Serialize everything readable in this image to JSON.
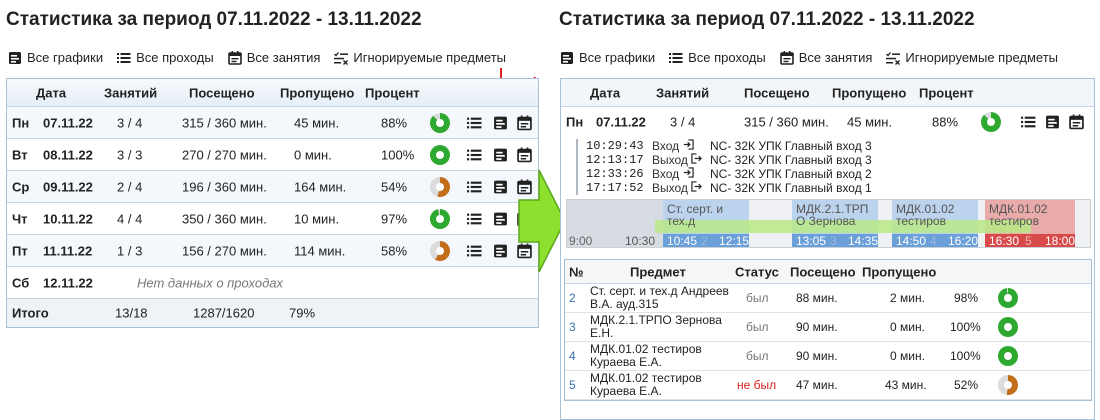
{
  "title": "Статистика за период 07.11.2022 - 13.11.2022",
  "toolbar": {
    "all_charts": "Все графики",
    "all_passes": "Все проходы",
    "all_lessons": "Все занятия",
    "ignored": "Игнорируемые предметы"
  },
  "table": {
    "headers": {
      "date": "Дата",
      "lessons": "Занятий",
      "attended": "Посещено",
      "missed": "Пропущено",
      "percent": "Процент"
    },
    "rows": [
      {
        "day": "Пн",
        "date": "07.11.22",
        "lessons": "3 / 4",
        "attended": "315 / 360 мин.",
        "missed": "45 мин.",
        "percent": "88%",
        "pct": 88
      },
      {
        "day": "Вт",
        "date": "08.11.22",
        "lessons": "3 / 3",
        "attended": "270 / 270 мин.",
        "missed": "0 мин.",
        "percent": "100%",
        "pct": 100
      },
      {
        "day": "Ср",
        "date": "09.11.22",
        "lessons": "2 / 4",
        "attended": "196 / 360 мин.",
        "missed": "164 мин.",
        "percent": "54%",
        "pct": 54
      },
      {
        "day": "Чт",
        "date": "10.11.22",
        "lessons": "4 / 4",
        "attended": "350 / 360 мин.",
        "missed": "10 мин.",
        "percent": "97%",
        "pct": 97
      },
      {
        "day": "Пт",
        "date": "11.11.22",
        "lessons": "1 / 3",
        "attended": "156 / 270 мин.",
        "missed": "114 мин.",
        "percent": "58%",
        "pct": 58
      }
    ],
    "saturday": {
      "day": "Сб",
      "date": "12.11.22",
      "note": "Нет данных о проходах"
    },
    "total": {
      "label": "Итого",
      "lessons": "13/18",
      "attended": "1287/1620",
      "percent": "79%"
    }
  },
  "expanded": {
    "day": "Пн",
    "date": "07.11.22",
    "lessons": "3 / 4",
    "attended": "315 / 360 мин.",
    "missed": "45 мин.",
    "percent": "88%",
    "pct": 88,
    "visits": [
      {
        "time": "10:29:43",
        "kind": "Вход",
        "dir": "in",
        "place": "NC- 32К УПК Главный вход 3"
      },
      {
        "time": "12:13:17",
        "kind": "Выход",
        "dir": "out",
        "place": "NC- 32К УПК Главный вход 3"
      },
      {
        "time": "12:33:26",
        "kind": "Вход",
        "dir": "in",
        "place": "NC- 32К УПК Главный вход 2"
      },
      {
        "time": "17:17:52",
        "kind": "Выход",
        "dir": "out",
        "place": "NC- 32К УПК Главный вход 1"
      }
    ],
    "timeline": {
      "day_start": "9:00",
      "lessons": [
        {
          "num": "1",
          "start": "9:00",
          "end": "10:30",
          "label": ""
        },
        {
          "num": "2",
          "start": "10:45",
          "end": "12:15",
          "label": "Ст. серт. и тех.д"
        },
        {
          "num": "3",
          "start": "13:05",
          "end": "14:35",
          "label": "МДК.2.1.ТРП О Зернова"
        },
        {
          "num": "4",
          "start": "14:50",
          "end": "16:20",
          "label": "МДК.01.02 тестиров"
        },
        {
          "num": "5",
          "start": "16:30",
          "end": "18:00",
          "label": "МДК.01.02 тестиров"
        }
      ]
    },
    "subtable": {
      "headers": {
        "num": "№",
        "subject": "Предмет",
        "status": "Статус",
        "attended": "Посещено",
        "missed": "Пропущено"
      },
      "rows": [
        {
          "num": "2",
          "subject": "Ст. серт. и тех.д Андреев В.А. ауд.315",
          "status": "был",
          "attended": "88 мин.",
          "missed": "2 мин.",
          "percent": "98%",
          "pct": 98
        },
        {
          "num": "3",
          "subject": "МДК.2.1.ТРПО Зернова Е.Н.",
          "status": "был",
          "attended": "90 мин.",
          "missed": "0 мин.",
          "percent": "100%",
          "pct": 100
        },
        {
          "num": "4",
          "subject": "МДК.01.02 тестиров Кураева Е.А.",
          "status": "был",
          "attended": "90 мин.",
          "missed": "0 мин.",
          "percent": "100%",
          "pct": 100
        },
        {
          "num": "5",
          "subject": "МДК.01.02 тестиров Кураева Е.А.",
          "status": "не был",
          "attended": "47 мин.",
          "missed": "43 мин.",
          "percent": "52%",
          "pct": 52
        }
      ]
    }
  },
  "colors": {
    "good": "#2ea82e",
    "warn": "#c26d1a",
    "mid": "#6b8e23",
    "border": "#a9c2dc",
    "red_arrow": "#e02020",
    "big_arrow": "#7ed321",
    "absent": "#d42020"
  }
}
